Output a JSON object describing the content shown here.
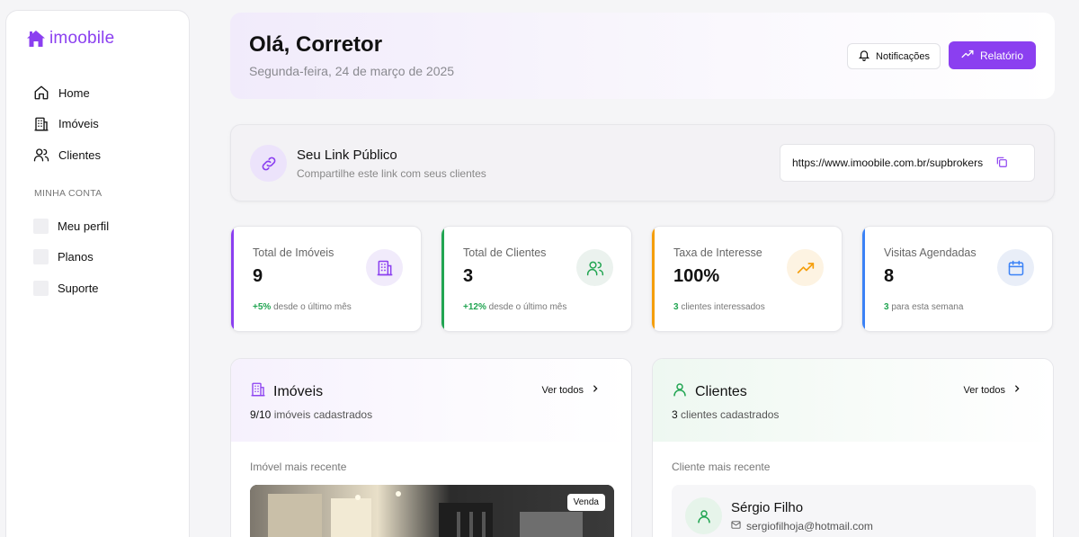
{
  "brand": {
    "name": "imoobile",
    "color": "#8b3ff0"
  },
  "sidebar": {
    "items": [
      {
        "label": "Home",
        "icon": "home-icon"
      },
      {
        "label": "Imóveis",
        "icon": "building-icon"
      },
      {
        "label": "Clientes",
        "icon": "users-icon"
      }
    ],
    "section_label": "MINHA CONTA",
    "account_items": [
      {
        "label": "Meu perfil"
      },
      {
        "label": "Planos"
      },
      {
        "label": "Suporte"
      }
    ]
  },
  "header": {
    "greeting": "Olá, Corretor",
    "date": "Segunda-feira, 24 de março de 2025",
    "notifications_label": "Notificações",
    "report_label": "Relatório"
  },
  "public_link": {
    "title": "Seu Link Público",
    "subtitle": "Compartilhe este link com seus clientes",
    "url": "https://www.imoobile.com.br/supbrokers"
  },
  "stats": [
    {
      "label": "Total de Imóveis",
      "value": "9",
      "highlight": "+5%",
      "foot": "desde o último mês",
      "accent": "#8b3ff0",
      "icon": "building-icon"
    },
    {
      "label": "Total de Clientes",
      "value": "3",
      "highlight": "+12%",
      "foot": "desde o último mês",
      "accent": "#22a552",
      "icon": "users-icon"
    },
    {
      "label": "Taxa de Interesse",
      "value": "100%",
      "highlight": "3",
      "foot": "clientes interessados",
      "accent": "#f59e0b",
      "icon": "trending-up-icon"
    },
    {
      "label": "Visitas Agendadas",
      "value": "8",
      "highlight": "3",
      "foot": "para esta semana",
      "accent": "#3b82f6",
      "icon": "calendar-icon"
    }
  ],
  "properties_panel": {
    "title": "Imóveis",
    "count": "9/10",
    "count_suffix": "imóveis cadastrados",
    "see_all": "Ver todos",
    "recent_label": "Imóvel mais recente",
    "badge": "Venda"
  },
  "clients_panel": {
    "title": "Clientes",
    "count": "3",
    "count_suffix": "clientes cadastrados",
    "see_all": "Ver todos",
    "recent_label": "Cliente mais recente",
    "client_name": "Sérgio Filho",
    "client_email": "sergiofilhoja@hotmail.com"
  }
}
